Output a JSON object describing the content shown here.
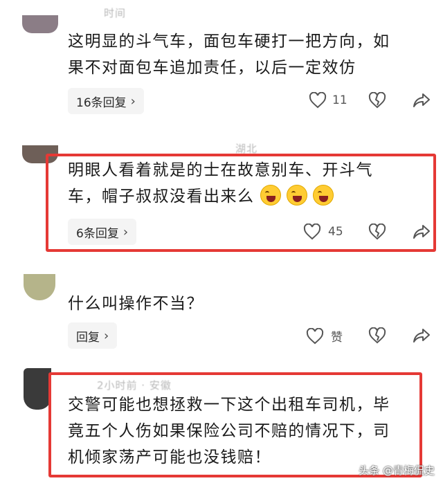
{
  "comments": [
    {
      "meta": "时间",
      "text_line1": "这明显的斗气车，面包车硬打一把方向，如",
      "text_line2": "果不对面包车追加责任，以后一定效仿",
      "reply_label": "16条回复",
      "likes": "11",
      "avatar_color": "#8b7d86"
    },
    {
      "meta": "湖北",
      "text_line1": "明眼人看着就是的士在故意别车、开斗气",
      "text_line2": "车，帽子叔叔没看出来么",
      "reply_label": "6条回复",
      "likes": "45",
      "avatar_color": "#6e5f58"
    },
    {
      "meta": "",
      "text_line1": "什么叫操作不当？",
      "reply_label": "回复",
      "likes": "赞",
      "avatar_color": "#b5b48a"
    },
    {
      "meta": "2小时前 · 安徽",
      "text_line1": "交警可能也想拯救一下这个出租车司机，毕",
      "text_line2": "竟五个人伤如果保险公司不赔的情况下，司",
      "text_line3": "机倾家荡产可能也没钱赔！",
      "avatar_color": "#3a3a3a"
    }
  ],
  "icons": {
    "heart": "heart-icon",
    "dislike": "broken-heart-icon",
    "share": "share-icon"
  },
  "watermark": "头条 @青梅侃史",
  "colors": {
    "highlight": "#e53935",
    "pill_bg": "#f4f4f4"
  }
}
